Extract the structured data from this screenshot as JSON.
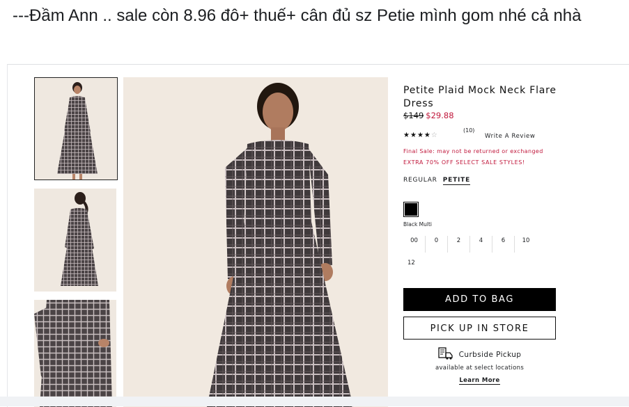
{
  "post": {
    "text": "---Đầm Ann .. sale còn 8.96 đô+ thuế+ cân đủ sz Petie mình gom nhé cả nhà"
  },
  "product": {
    "title": "Petite Plaid Mock Neck Flare Dress",
    "old_price": "$149",
    "new_price": "$29.88",
    "rating": 4,
    "rating_max": 5,
    "review_count": "(10)",
    "write_review": "Write A Review",
    "final_sale": "Final Sale: may not be returned or exchanged",
    "extra_off": "EXTRA 70% OFF SELECT SALE STYLES!",
    "size_types": {
      "regular": "REGULAR",
      "petite": "PETITE",
      "selected": "PETITE"
    },
    "color": {
      "name": "Black Multi",
      "swatch": "#000000"
    },
    "sizes": [
      "00",
      "0",
      "2",
      "4",
      "6",
      "10",
      "12"
    ],
    "add_to_bag": "ADD TO BAG",
    "pickup": "PICK UP IN STORE",
    "curbside": {
      "title": "Curbside Pickup",
      "subtitle": "available at select locations",
      "learn_more": "Learn More"
    }
  },
  "colors": {
    "price_red": "#c0173b",
    "button_black": "#000000"
  },
  "icons": {
    "stars": "star-icon",
    "curbside": "store-pickup-icon"
  }
}
